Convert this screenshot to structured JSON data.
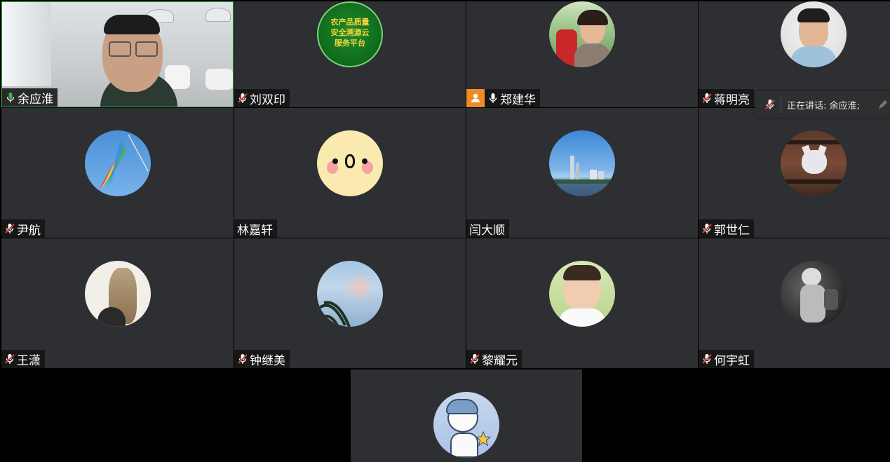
{
  "participants": [
    {
      "name": "余应淮",
      "mic": "on"
    },
    {
      "name": "刘双印",
      "mic": "muted"
    },
    {
      "name": "郑建华",
      "mic": "on",
      "host_badge": true
    },
    {
      "name": "蒋明亮",
      "mic": "muted"
    },
    {
      "name": "尹航",
      "mic": "muted"
    },
    {
      "name": "林嘉轩",
      "mic": "none"
    },
    {
      "name": "闫大顺",
      "mic": "none"
    },
    {
      "name": "郭世仁",
      "mic": "muted"
    },
    {
      "name": "王潇",
      "mic": "muted"
    },
    {
      "name": "钟继美",
      "mic": "muted"
    },
    {
      "name": "黎耀元",
      "mic": "muted"
    },
    {
      "name": "何宇虹",
      "mic": "muted"
    }
  ],
  "logo_avatar_text": [
    "农产品质量",
    "安全溯源云",
    "服务平台"
  ],
  "speaking_indicator": "正在讲话: 余应淮;",
  "colors": {
    "tile_bg": "#2d2f32",
    "active_border": "#3bb34a",
    "mic_on": "#3bb34a",
    "mic_muted": "#e23b3b"
  },
  "icons": [
    "mic-on-icon",
    "mic-muted-icon",
    "person-icon",
    "pencil-icon"
  ]
}
